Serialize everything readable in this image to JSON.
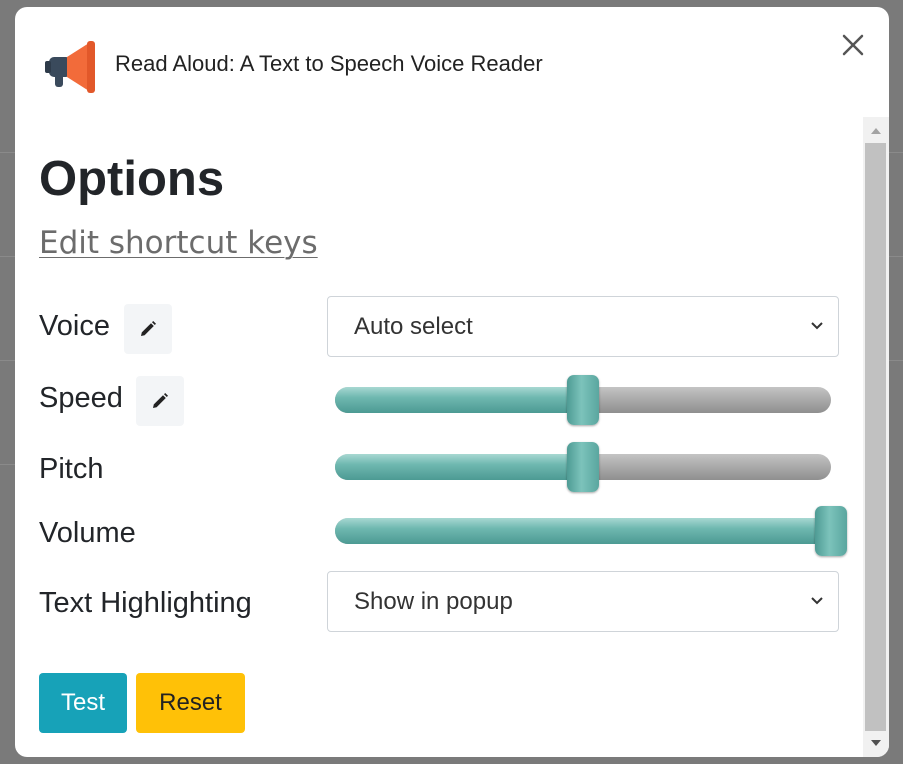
{
  "app": {
    "title": "Read Aloud: A Text to Speech Voice Reader",
    "icon": "megaphone-icon"
  },
  "page": {
    "heading": "Options",
    "shortcut_link": "Edit shortcut keys"
  },
  "options": {
    "voice": {
      "label": "Voice",
      "value": "Auto select"
    },
    "speed": {
      "label": "Speed",
      "value_fraction": 0.5
    },
    "pitch": {
      "label": "Pitch",
      "value_fraction": 0.5
    },
    "volume": {
      "label": "Volume",
      "value_fraction": 1.0
    },
    "highlighting": {
      "label": "Text Highlighting",
      "value": "Show in popup"
    }
  },
  "buttons": {
    "test": "Test",
    "reset": "Reset"
  },
  "colors": {
    "accent_slider": "#6fb8b0",
    "test_button": "#17a2b8",
    "reset_button": "#ffc107"
  }
}
